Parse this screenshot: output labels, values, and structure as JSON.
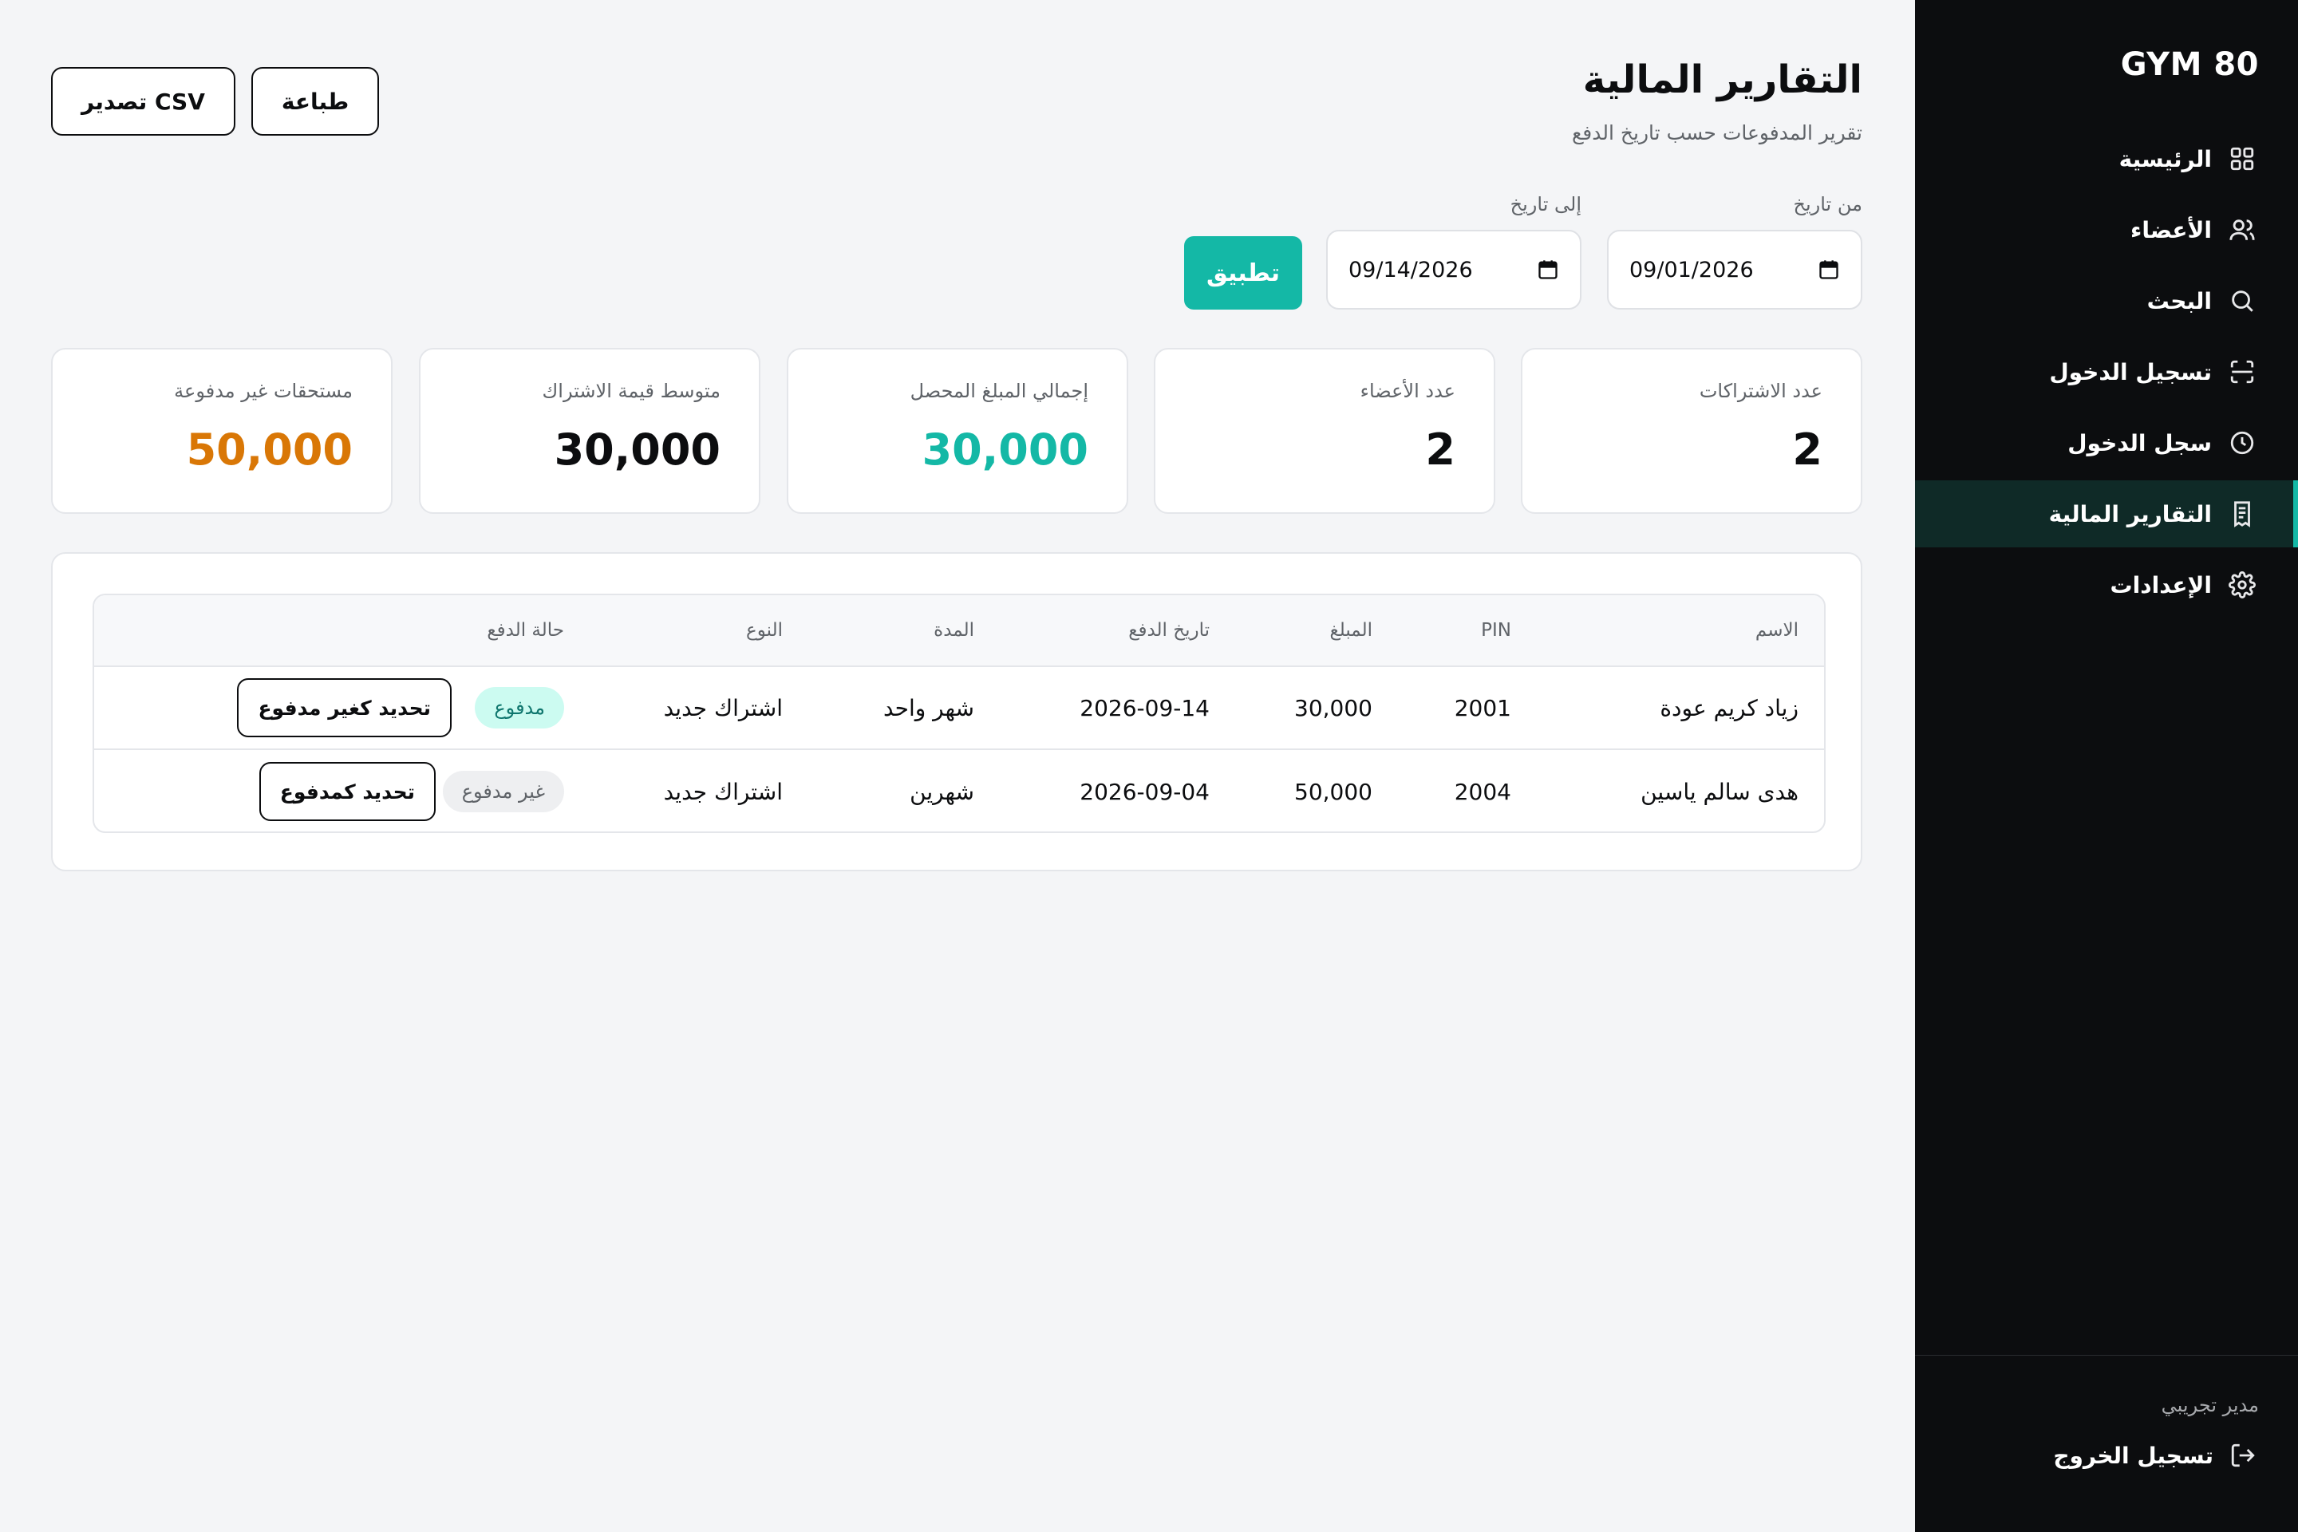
{
  "app": {
    "brand": "GYM 80"
  },
  "sidebar": {
    "items": [
      {
        "label": "الرئيسية",
        "icon": "grid-icon"
      },
      {
        "label": "الأعضاء",
        "icon": "users-icon"
      },
      {
        "label": "البحث",
        "icon": "search-icon"
      },
      {
        "label": "تسجيل الدخول",
        "icon": "scan-icon"
      },
      {
        "label": "سجل الدخول",
        "icon": "clock-icon"
      },
      {
        "label": "التقارير المالية",
        "icon": "receipt-icon",
        "active": true
      },
      {
        "label": "الإعدادات",
        "icon": "gear-icon"
      }
    ],
    "user": "مدير تجريبي",
    "logout": "تسجيل الخروج"
  },
  "header": {
    "title": "التقارير المالية",
    "subtitle": "تقرير المدفوعات حسب تاريخ الدفع",
    "export_label": "تصدير CSV",
    "print_label": "طباعة"
  },
  "filter": {
    "from_label": "من تاريخ",
    "from_value": "09/01/2026",
    "to_label": "إلى تاريخ",
    "to_value": "09/14/2026",
    "apply_label": "تطبيق"
  },
  "kpis": [
    {
      "label": "عدد الاشتراكات",
      "value": "2",
      "color": "#0c0d0f"
    },
    {
      "label": "عدد الأعضاء",
      "value": "2",
      "color": "#0c0d0f"
    },
    {
      "label": "إجمالي المبلغ المحصل",
      "value": "30,000",
      "color": "#14b8a6"
    },
    {
      "label": "متوسط قيمة الاشتراك",
      "value": "30,000",
      "color": "#0c0d0f"
    },
    {
      "label": "مستحقات غير مدفوعة",
      "value": "50,000",
      "color": "#d97706"
    }
  ],
  "table": {
    "headers": {
      "name": "الاسم",
      "pin": "PIN",
      "amount": "المبلغ",
      "date": "تاريخ الدفع",
      "duration": "المدة",
      "type": "النوع",
      "status": "حالة الدفع"
    },
    "rows": [
      {
        "name": "زياد كريم عودة",
        "pin": "2001",
        "amount": "30,000",
        "date": "2026-09-14",
        "duration": "شهر واحد",
        "type": "اشتراك جديد",
        "status": "مدفوع",
        "status_kind": "paid",
        "action": "تحديد كغير مدفوع"
      },
      {
        "name": "هدى سالم ياسين",
        "pin": "2004",
        "amount": "50,000",
        "date": "2026-09-04",
        "duration": "شهرين",
        "type": "اشتراك جديد",
        "status": "غير مدفوع",
        "status_kind": "unpaid",
        "action": "تحديد كمدفوع"
      }
    ]
  },
  "colors": {
    "accent": "#14b8a6",
    "warning": "#d97706",
    "sidebar_bg": "#0c0d0f"
  }
}
